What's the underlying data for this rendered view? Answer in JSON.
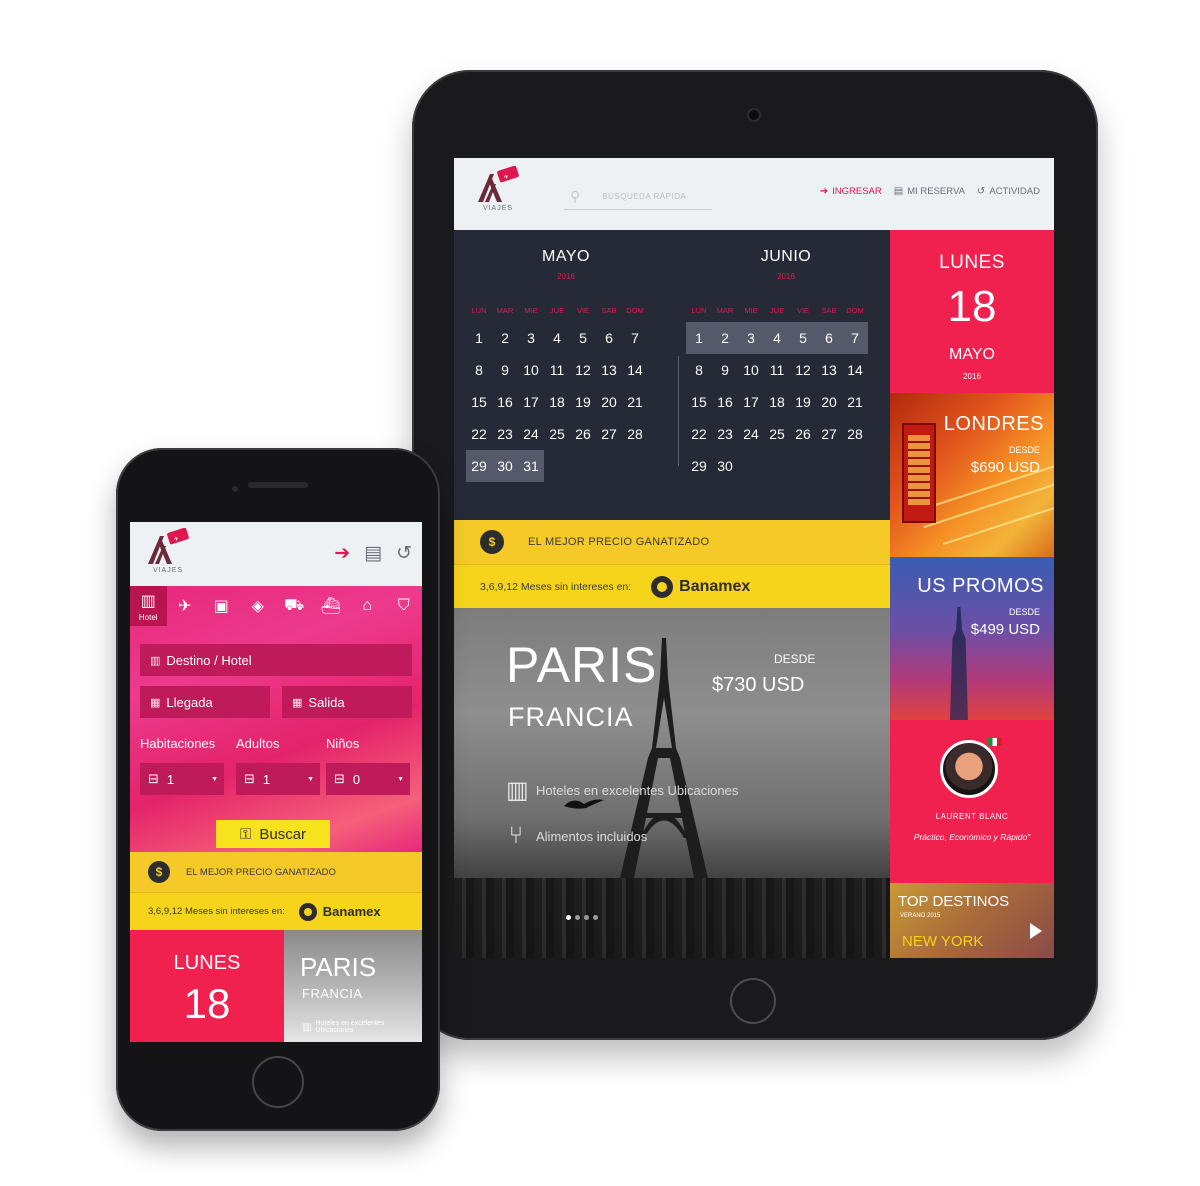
{
  "brand": {
    "logo_text": "VIAJES",
    "accent": "#e0174e",
    "dark": "#262a37",
    "yellow": "#f5c928"
  },
  "tablet": {
    "search_placeholder": "BÚSQUEDA RÁPIDA",
    "nav": [
      {
        "label": "INGRESAR",
        "icon": "login-icon"
      },
      {
        "label": "MI RESERVA",
        "icon": "document-icon"
      },
      {
        "label": "ACTIVIDAD",
        "icon": "history-icon"
      }
    ],
    "dow": [
      "LUN",
      "MAR",
      "MIE",
      "JUE",
      "VIE",
      "SAB",
      "DOM"
    ],
    "calendars": [
      {
        "month": "MAYO",
        "year": "2016",
        "days": 31,
        "selected": [
          29,
          30,
          31
        ]
      },
      {
        "month": "JUNIO",
        "year": "2016",
        "days": 30,
        "selected": [
          1,
          2,
          3,
          4,
          5,
          6,
          7
        ]
      }
    ],
    "date_tile": {
      "day": "LUNES",
      "num": "18",
      "month": "MAYO",
      "year": "2016"
    },
    "london": {
      "title": "LONDRES",
      "desde": "DESDE",
      "price": "$690 USD"
    },
    "us": {
      "title": "US PROMOS",
      "desde": "DESDE",
      "price": "$499 USD"
    },
    "review": {
      "name": "LAURENT BLANC",
      "quote": "Práctico, Económico y Rápido\""
    },
    "top": {
      "title": "TOP DESTINOS",
      "subtitle": "VERANO 2015",
      "city": "NEW YORK"
    },
    "banner_price": "EL MEJOR PRECIO GANATIZADO",
    "banner_meses": "3,6,9,12 Meses sin intereses en:",
    "bank": "Banamex",
    "hero": {
      "city": "PARIS",
      "country": "FRANCIA",
      "desde": "DESDE",
      "price": "$730 USD",
      "feature1": "Hoteles en excelentes Ubicaciones",
      "feature2": "Alimentos incluidos"
    }
  },
  "phone": {
    "tabs": [
      {
        "icon": "hotel-icon",
        "label": "Hotel",
        "glyph": "▥"
      },
      {
        "icon": "plane-icon",
        "glyph": "✈"
      },
      {
        "icon": "luggage-icon",
        "glyph": "▣"
      },
      {
        "icon": "ticket-icon",
        "glyph": "◈"
      },
      {
        "icon": "car-icon",
        "glyph": "⛟"
      },
      {
        "icon": "ship-icon",
        "glyph": "⛴"
      },
      {
        "icon": "home-icon",
        "glyph": "⌂"
      },
      {
        "icon": "shield-icon",
        "glyph": "⛉"
      }
    ],
    "destino_placeholder": "Destino / Hotel",
    "llegada_placeholder": "Llegada",
    "salida_placeholder": "Salida",
    "labels": {
      "habitaciones": "Habitaciones",
      "adultos": "Adultos",
      "ninos": "Niños"
    },
    "values": {
      "habitaciones": "1",
      "adultos": "1",
      "ninos": "0"
    },
    "buscar": "Buscar",
    "banner_price": "EL MEJOR PRECIO GANATIZADO",
    "banner_meses": "3,6,9,12 Meses sin intereses en:",
    "bank": "Banamex",
    "date_tile": {
      "day": "LUNES",
      "num": "18"
    },
    "paris": {
      "city": "PARIS",
      "country": "FRANCIA",
      "feature": "Hoteles en excelentes Ubicaciones"
    }
  }
}
